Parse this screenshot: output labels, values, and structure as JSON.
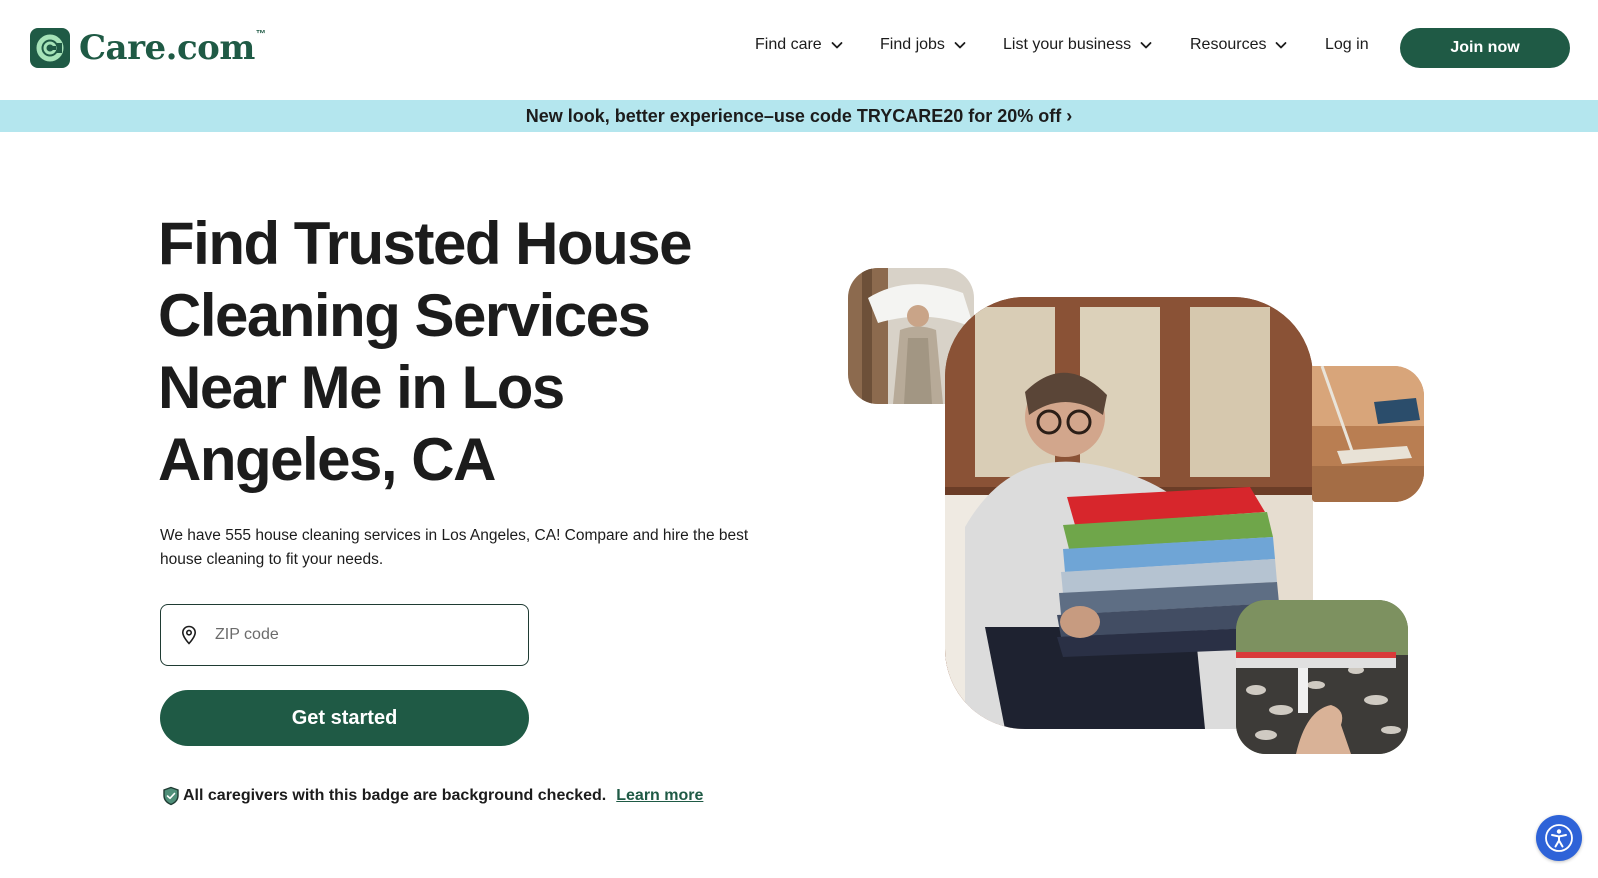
{
  "brand": {
    "name": "Care.com",
    "trademark": "™"
  },
  "nav": {
    "items": [
      {
        "label": "Find care",
        "has_dropdown": true
      },
      {
        "label": "Find jobs",
        "has_dropdown": true
      },
      {
        "label": "List your business",
        "has_dropdown": true
      },
      {
        "label": "Resources",
        "has_dropdown": true
      },
      {
        "label": "Log in",
        "has_dropdown": false
      }
    ],
    "join_label": "Join now"
  },
  "promo": {
    "text": "New look, better experience–use code TRYCARE20 for 20% off ›"
  },
  "hero": {
    "title": "Find Trusted House Cleaning Services Near Me in Los Angeles, CA",
    "description": "We have 555 house cleaning services in Los Angeles, CA! Compare and hire the best house cleaning to fit your needs.",
    "zip_placeholder": "ZIP code",
    "zip_value": "",
    "cta_label": "Get started",
    "badge_text": "All caregivers with this badge are background checked.",
    "learn_more_label": "Learn more"
  },
  "icons": {
    "logo": "care-logo-icon",
    "dropdown": "chevron-down-icon",
    "location": "location-pin-icon",
    "badge": "shield-check-icon",
    "accessibility": "accessibility-icon"
  },
  "colors": {
    "brand_green": "#1f5a45",
    "promo_bg": "#b4e6ee",
    "accessibility_blue": "#2e63d8",
    "text": "#1c1c1c"
  }
}
